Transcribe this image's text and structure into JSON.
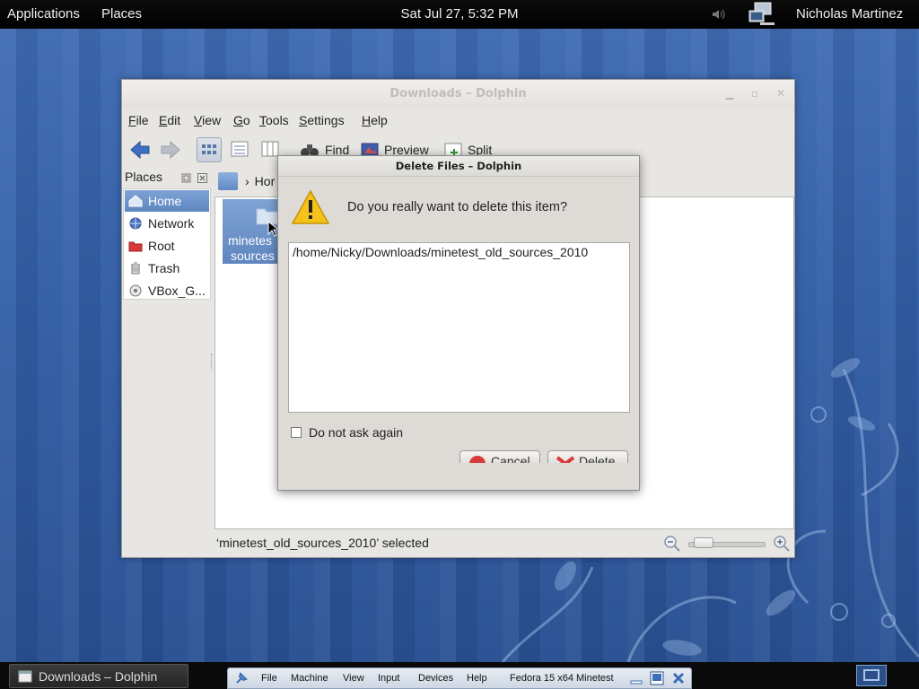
{
  "top_panel": {
    "applications": "Applications",
    "places": "Places",
    "clock": "Sat Jul 27,  5:32 PM",
    "user": "Nicholas Martinez"
  },
  "dolphin": {
    "title": "Downloads – Dolphin",
    "menu": [
      "File",
      "Edit",
      "View",
      "Go",
      "Tools",
      "Settings",
      "Help"
    ],
    "toolbar": {
      "find": "Find",
      "preview": "Preview",
      "split": "Split"
    },
    "places_header": "Places",
    "places": [
      "Home",
      "Network",
      "Root",
      "Trash",
      "VBox_G..."
    ],
    "breadcrumb": "Hor",
    "folder_label_line1": "minetes",
    "folder_label_line2": "sources",
    "status": "‘minetest_old_sources_2010’ selected"
  },
  "dialog": {
    "title": "Delete Files – Dolphin",
    "question": "Do you really want to delete this item?",
    "path": "/home/Nicky/Downloads/minetest_old_sources_2010",
    "dont_ask": "Do not ask again",
    "cancel": "Cancel",
    "delete": "Delete"
  },
  "taskbar": {
    "dolphin_task": "Downloads – Dolphin"
  },
  "vbox": {
    "menu": [
      "File",
      "Machine",
      "View",
      "Input",
      "Devices",
      "Help"
    ],
    "vm_name": "Fedora 15 x64 Minetest"
  },
  "colors": {
    "desktop": "#325ea6",
    "selection": "#5d87c2",
    "panel": "#000000"
  }
}
